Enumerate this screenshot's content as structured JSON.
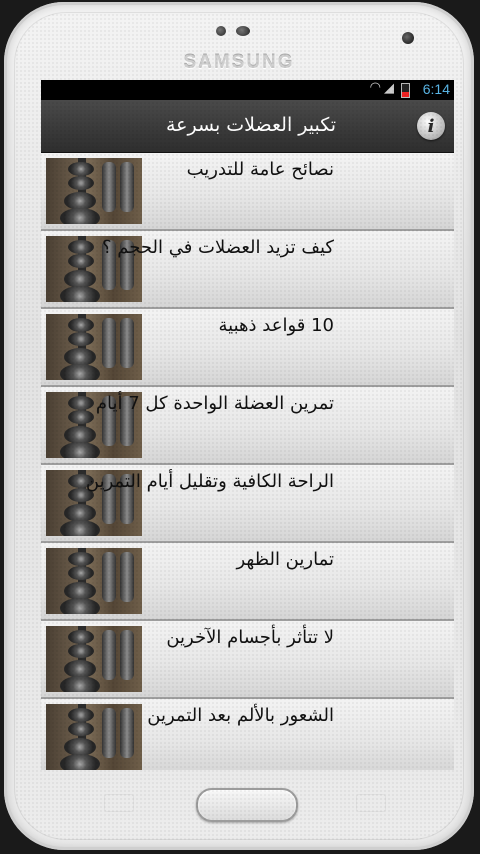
{
  "device": {
    "brand": "SAMSUNG"
  },
  "statusbar": {
    "time": "6:14"
  },
  "app": {
    "title": "تكبير العضلات بسرعة",
    "info_icon": "info-icon"
  },
  "list": {
    "items": [
      {
        "label": "نصائح عامة للتدريب"
      },
      {
        "label": "كيف تزيد العضلات في الحجم ؟"
      },
      {
        "label": "10 قواعد ذهبية"
      },
      {
        "label": "تمرين العضلة الواحدة كل 7 أيام"
      },
      {
        "label": "الراحة الكافية وتقليل أيام التمرين"
      },
      {
        "label": "تمارين الظهر"
      },
      {
        "label": "لا تتأثر بأجسام الآخرين"
      },
      {
        "label": "الشعور بالألم بعد التمرين"
      }
    ]
  }
}
